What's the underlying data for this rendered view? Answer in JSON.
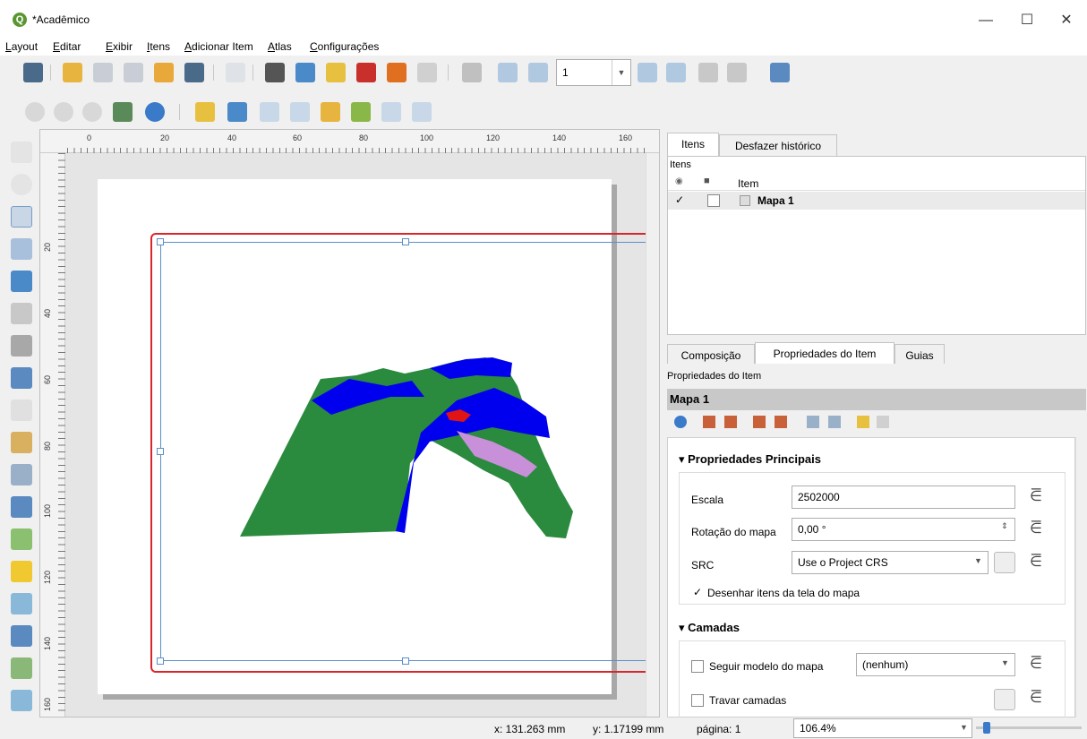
{
  "window": {
    "title": "*Acadêmico",
    "app_icon": "Q",
    "minimize": "—",
    "maximize": "☐",
    "close": "✕"
  },
  "menu": [
    "Layout",
    "Editar",
    "Exibir",
    "Itens",
    "Adicionar Item",
    "Atlas",
    "Configurações"
  ],
  "toolbar": {
    "page_value": "1"
  },
  "ruler": {
    "h_labels": [
      "0",
      "20",
      "40",
      "60",
      "80",
      "100",
      "120",
      "140",
      "160"
    ],
    "v_labels": [
      "20",
      "40",
      "60",
      "80",
      "100",
      "120",
      "140",
      "160"
    ]
  },
  "tabs_top": {
    "items": "Itens",
    "undo": "Desfazer histórico"
  },
  "items_panel": {
    "title": "Itens",
    "col_item": "Item",
    "rows": [
      {
        "name": "Mapa 1",
        "visible": true,
        "locked": false
      }
    ]
  },
  "tabs_bottom": {
    "composition": "Composição",
    "item_props": "Propriedades do Item",
    "guides": "Guias"
  },
  "props": {
    "panel_title": "Propriedades do Item",
    "item_name": "Mapa 1",
    "main_section": "Propriedades Principais",
    "scale_label": "Escala",
    "scale_value": "2502000",
    "rotation_label": "Rotação do mapa",
    "rotation_value": "0,00 °",
    "src_label": "SRC",
    "src_value": "Use o Project CRS",
    "draw_items_label": "Desenhar itens da tela do mapa",
    "layers_section": "Camadas",
    "follow_theme_label": "Seguir modelo do mapa",
    "follow_theme_value": "(nenhum)",
    "lock_layers_label": "Travar camadas"
  },
  "status": {
    "x": "x: 131.263 mm",
    "y": "y: 1.17199 mm",
    "page": "página: 1",
    "zoom": "106.4%"
  }
}
